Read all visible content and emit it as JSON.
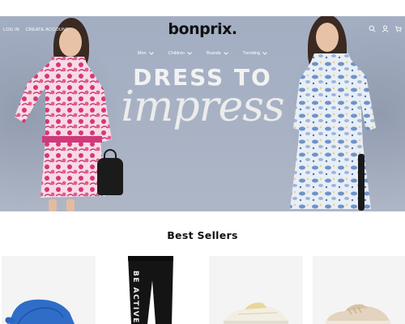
{
  "header": {
    "log_in": "LOG IN",
    "create_account": "CREATE ACCOUNT",
    "logo": "bonprix.",
    "icons": [
      "search-icon",
      "user-icon",
      "cart-icon"
    ]
  },
  "nav": {
    "items": [
      {
        "label": "Men"
      },
      {
        "label": "Children"
      },
      {
        "label": "Brands"
      },
      {
        "label": "Trending"
      }
    ]
  },
  "hero": {
    "headline_line1": "DRESS TO",
    "headline_line2": "impress"
  },
  "best_sellers": {
    "title": "Best Sellers",
    "products": [
      {
        "name": "blue-cap"
      },
      {
        "name": "black-joggers"
      },
      {
        "name": "cream-sneakers"
      },
      {
        "name": "beige-sneakers"
      }
    ],
    "jogger_print": "BE ACTIVE"
  }
}
